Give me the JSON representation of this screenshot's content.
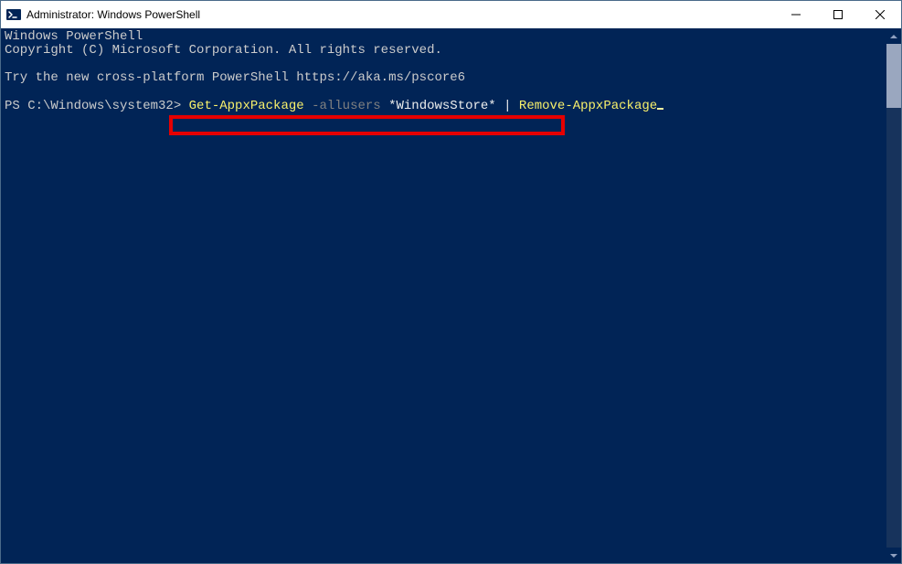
{
  "titlebar": {
    "title": "Administrator: Windows PowerShell"
  },
  "console": {
    "line1": "Windows PowerShell",
    "line2": "Copyright (C) Microsoft Corporation. All rights reserved.",
    "line4": "Try the new cross-platform PowerShell https://aka.ms/pscore6",
    "prompt": "PS C:\\Windows\\system32> ",
    "cmd": {
      "part1": "Get-AppxPackage",
      "part2": " -allusers",
      "part3": " *WindowsStore* ",
      "pipe": "|",
      "part4": " Remove-AppxPackage"
    }
  }
}
